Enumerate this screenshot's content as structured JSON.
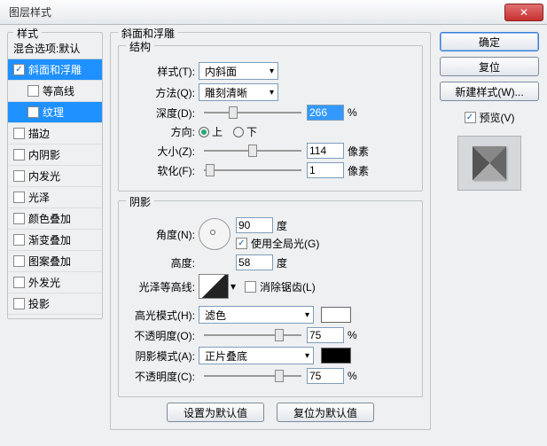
{
  "window": {
    "title": "图层样式"
  },
  "sidebar": {
    "header": "样式",
    "blend": "混合选项:默认",
    "items": [
      {
        "label": "斜面和浮雕",
        "checked": true,
        "selected": true
      },
      {
        "label": "等高线",
        "checked": false,
        "sub": true
      },
      {
        "label": "纹理",
        "checked": false,
        "sub": true,
        "selected": true
      },
      {
        "label": "描边",
        "checked": false
      },
      {
        "label": "内阴影",
        "checked": false
      },
      {
        "label": "内发光",
        "checked": false
      },
      {
        "label": "光泽",
        "checked": false
      },
      {
        "label": "颜色叠加",
        "checked": false
      },
      {
        "label": "渐变叠加",
        "checked": false
      },
      {
        "label": "图案叠加",
        "checked": false
      },
      {
        "label": "外发光",
        "checked": false
      },
      {
        "label": "投影",
        "checked": false
      }
    ]
  },
  "main": {
    "group_title": "斜面和浮雕",
    "structure": {
      "title": "结构",
      "style_label": "样式(T):",
      "style_value": "内斜面",
      "technique_label": "方法(Q):",
      "technique_value": "雕刻清晰",
      "depth_label": "深度(D):",
      "depth_value": "266",
      "depth_unit": "%",
      "direction_label": "方向:",
      "up": "上",
      "down": "下",
      "size_label": "大小(Z):",
      "size_value": "114",
      "size_unit": "像素",
      "soften_label": "软化(F):",
      "soften_value": "1",
      "soften_unit": "像素"
    },
    "shading": {
      "title": "阴影",
      "angle_label": "角度(N):",
      "angle_value": "90",
      "angle_unit": "度",
      "global_light": "使用全局光(G)",
      "altitude_label": "高度:",
      "altitude_value": "58",
      "altitude_unit": "度",
      "gloss_label": "光泽等高线:",
      "antialias": "消除锯齿(L)",
      "hl_mode_label": "高光模式(H):",
      "hl_mode_value": "滤色",
      "hl_opacity_label": "不透明度(O):",
      "hl_opacity_value": "75",
      "pct": "%",
      "sh_mode_label": "阴影模式(A):",
      "sh_mode_value": "正片叠底",
      "sh_opacity_label": "不透明度(C):",
      "sh_opacity_value": "75"
    },
    "reset_default": "设置为默认值",
    "restore_default": "复位为默认值"
  },
  "right": {
    "ok": "确定",
    "cancel": "复位",
    "new_style": "新建样式(W)...",
    "preview": "预览(V)"
  }
}
